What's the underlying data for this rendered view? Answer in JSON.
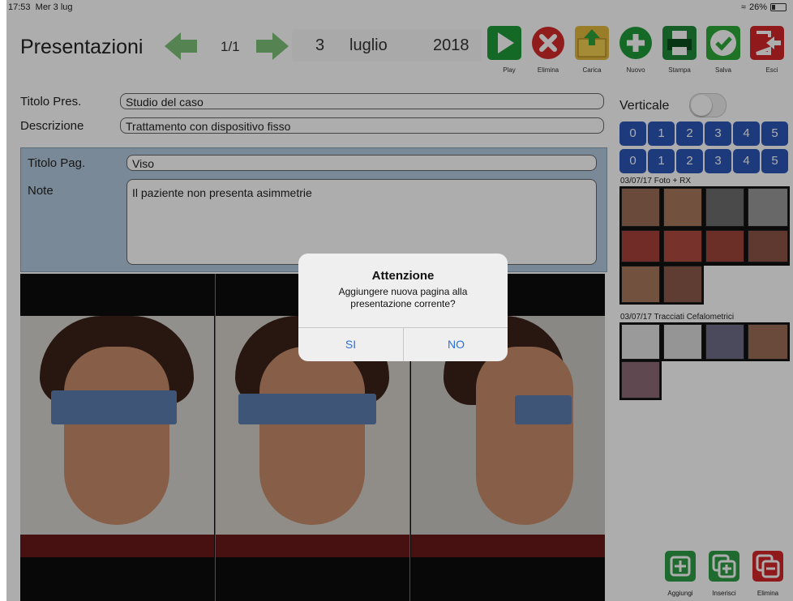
{
  "status_bar": {
    "time": "17:53",
    "day": "Mer 3 lug",
    "battery": "26%"
  },
  "header": {
    "title": "Presentazioni",
    "page_counter": "1/1",
    "date": {
      "day": "3",
      "month": "luglio",
      "year": "2018"
    }
  },
  "toolbar": [
    {
      "label": "Play",
      "color": "#1f9b3a",
      "icon": "play-icon"
    },
    {
      "label": "Elimina",
      "color": "#d42a2a",
      "icon": "close-icon"
    },
    {
      "label": "Carica",
      "color": "#e2b93b",
      "icon": "folder-upload-icon"
    },
    {
      "label": "Nuovo",
      "color": "#1f9b3a",
      "icon": "plus-icon"
    },
    {
      "label": "Stampa",
      "color": "#1f8b3a",
      "icon": "printer-icon"
    },
    {
      "label": "Salva",
      "color": "#2daa3a",
      "icon": "check-icon"
    },
    {
      "label": "Esci",
      "color": "#d4262a",
      "icon": "exit-icon"
    }
  ],
  "form": {
    "titolo_pres_label": "Titolo Pres.",
    "titolo_pres_value": "Studio del caso",
    "descrizione_label": "Descrizione",
    "descrizione_value": "Trattamento con dispositivo fisso",
    "titolo_pag_label": "Titolo Pag.",
    "titolo_pag_value": "Viso",
    "note_label": "Note",
    "note_value": "Il paziente non presenta asimmetrie"
  },
  "right_panel": {
    "verticale_label": "Verticale",
    "row1": [
      "0",
      "1",
      "2",
      "3",
      "4",
      "5"
    ],
    "row2": [
      "0",
      "1",
      "2",
      "3",
      "4",
      "5"
    ],
    "group1_title": "03/07/17 Foto + RX",
    "group2_title": "03/07/17 Tracciati Cefalometrici"
  },
  "bottom_buttons": [
    {
      "label": "Aggiungi",
      "color": "#2e9c44",
      "icon": "add-page-icon"
    },
    {
      "label": "Inserisci",
      "color": "#2e9c44",
      "icon": "insert-page-icon"
    },
    {
      "label": "Elimina",
      "color": "#d4262a",
      "icon": "remove-page-icon"
    }
  ],
  "dialog": {
    "title": "Attenzione",
    "message": "Aggiungere nuova pagina alla presentazione corrente?",
    "yes": "SI",
    "no": "NO"
  },
  "colors": {
    "accent": "#2a70e0",
    "number_button": "#2c56b8",
    "page_panel": "#b4cbe0",
    "blur_bar": "#5d7eb0"
  }
}
